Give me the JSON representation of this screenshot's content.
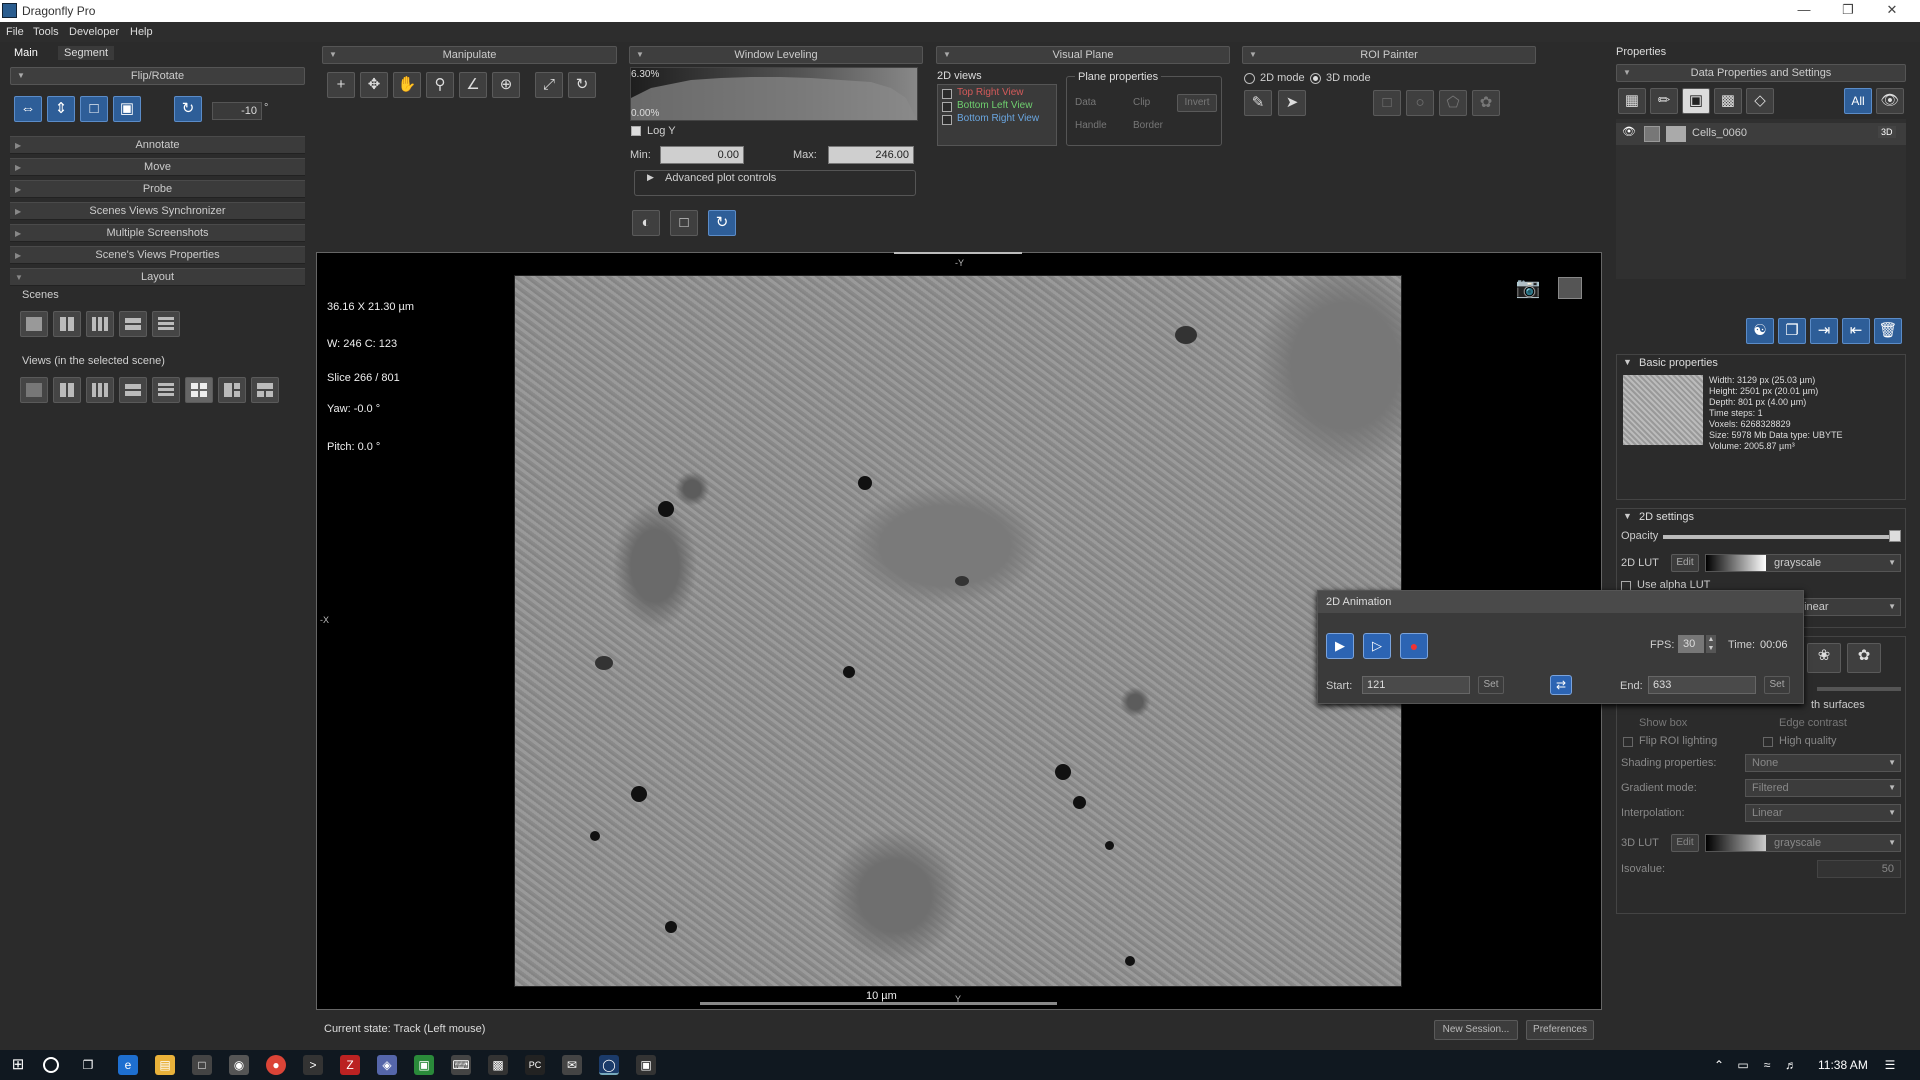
{
  "app": {
    "title": "Dragonfly Pro"
  },
  "menu": [
    "File",
    "Tools",
    "Developer",
    "Help"
  ],
  "main_tabs": [
    "Main",
    "Segment"
  ],
  "left_panel": {
    "flip_rotate": "Flip/Rotate",
    "rotate_value": "-10",
    "degree": "°",
    "sections": [
      "Annotate",
      "Move",
      "Probe",
      "Scenes Views Synchronizer",
      "Multiple Screenshots",
      "Scene's Views Properties",
      "Layout"
    ],
    "scenes_label": "Scenes",
    "views_label": "Views (in the selected scene)"
  },
  "toolbar": {
    "manipulate": "Manipulate",
    "window_leveling": "Window Leveling",
    "visual_plane": "Visual Plane",
    "roi_painter": "ROI Painter",
    "hist_top": "6.30%",
    "hist_bottom": "0.00%",
    "log_y": "Log Y",
    "min_label": "Min:",
    "min_value": "0.00",
    "max_label": "Max:",
    "max_value": "246.00",
    "advanced": "Advanced plot controls",
    "views_2d": "2D views",
    "view_items": [
      "Top Right View",
      "Bottom Left View",
      "Bottom Right View"
    ],
    "plane_props": "Plane properties",
    "plane_opts": [
      "Data",
      "Clip",
      "Invert",
      "Handle",
      "Border"
    ],
    "mode_2d": "2D mode",
    "mode_3d": "3D mode"
  },
  "viewport": {
    "dims": "36.16 X 21.30 µm",
    "wc": "W: 246 C: 123",
    "slice": "Slice 266 / 801",
    "yaw": "Yaw: -0.0 °",
    "pitch": "Pitch: 0.0 °",
    "axis_top": "-Y",
    "axis_left": "-X",
    "axis_bottom": "Y",
    "scale": "10 µm"
  },
  "status": {
    "state": "Current state: Track (Left mouse)",
    "new_session": "New Session...",
    "preferences": "Preferences"
  },
  "properties": {
    "title": "Properties",
    "data_settings": "Data Properties and Settings",
    "all_btn": "All",
    "dataset": "Cells_0060",
    "badge_3d": "3D",
    "basic": "Basic properties",
    "basic_lines": [
      "Width: 3129 px (25.03 µm)",
      "Height: 2501 px (20.01 µm)",
      "Depth: 801 px (4.00 µm)",
      "Time steps: 1",
      "Voxels: 6268328829",
      "Size: 5978 Mb  Data type: UBYTE",
      "Volume: 2005.87 µm³"
    ],
    "settings_2d": "2D settings",
    "opacity": "Opacity",
    "lut_2d": "2D LUT",
    "edit": "Edit",
    "grayscale": "grayscale",
    "use_alpha": "Use alpha LUT",
    "interpolation": "Interpolation:",
    "linear": "Linear",
    "surfaces": "th surfaces",
    "show_box": "Show box",
    "edge_contrast": "Edge contrast",
    "flip_roi": "Flip ROI lighting",
    "high_quality": "High quality",
    "shading": "Shading properties:",
    "none": "None",
    "gradient": "Gradient mode:",
    "filtered": "Filtered",
    "lut_3d": "3D LUT",
    "isovalue": "Isovalue:",
    "iso_val": "50"
  },
  "animation": {
    "title": "2D Animation",
    "fps_label": "FPS:",
    "fps": "30",
    "time_label": "Time:",
    "time": "00:06",
    "start_label": "Start:",
    "start": "121",
    "set": "Set",
    "end_label": "End:",
    "end": "633"
  },
  "taskbar": {
    "time": "11:38 AM"
  }
}
